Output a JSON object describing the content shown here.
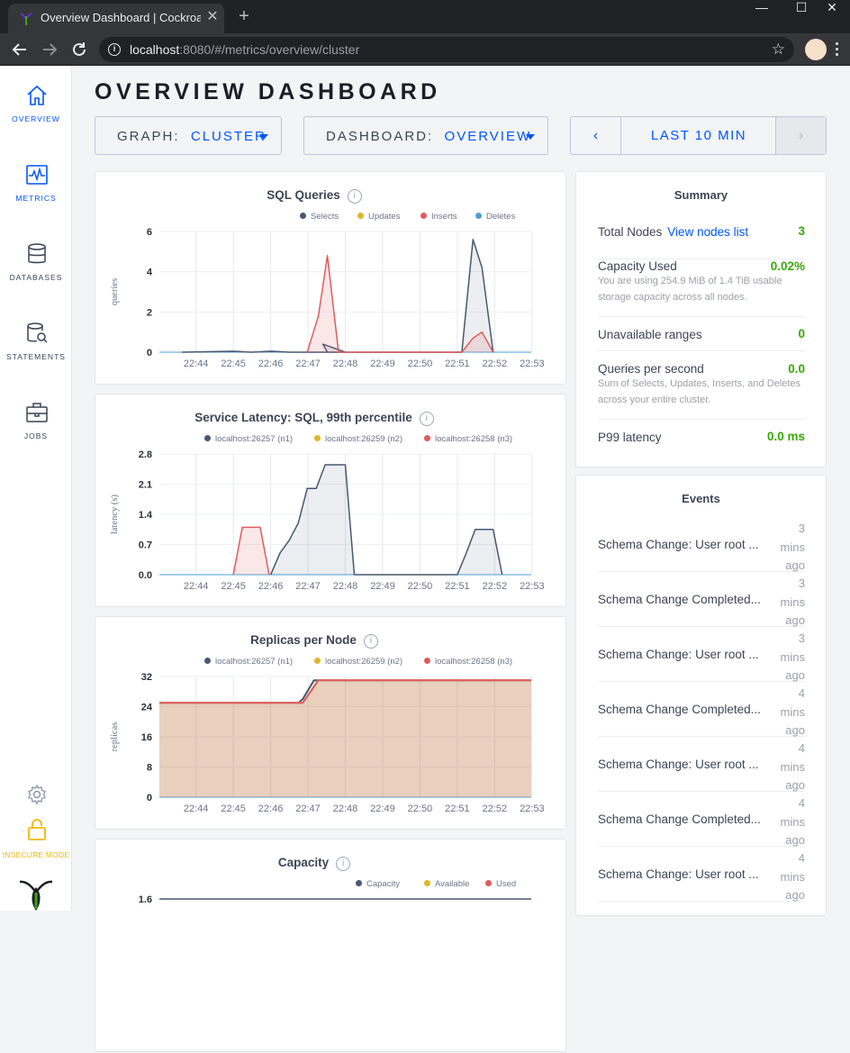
{
  "browser": {
    "tab_title": "Overview Dashboard | Cockroach",
    "url_host": "localhost",
    "url_rest": ":8080/#/metrics/overview/cluster"
  },
  "sidebar": {
    "items": [
      {
        "label": "OVERVIEW",
        "icon": "home-icon"
      },
      {
        "label": "METRICS",
        "icon": "metrics-icon"
      },
      {
        "label": "DATABASES",
        "icon": "database-icon"
      },
      {
        "label": "STATEMENTS",
        "icon": "statements-icon"
      },
      {
        "label": "JOBS",
        "icon": "jobs-icon"
      }
    ],
    "insecure_label": "INSECURE MODE"
  },
  "header": {
    "title": "OVERVIEW DASHBOARD",
    "graph_label": "GRAPH:",
    "graph_value": "CLUSTER",
    "dashboard_label": "DASHBOARD:",
    "dashboard_value": "OVERVIEW",
    "time_range": "LAST 10 MIN"
  },
  "colors": {
    "accent": "#0055ff",
    "n1": "#475872",
    "n2": "#e0b72c",
    "n3": "#e05c5c",
    "deletes": "#4aa0d5",
    "good": "#37a806"
  },
  "chart_data": [
    {
      "type": "area",
      "title": "SQL Queries",
      "ylabel": "queries",
      "ylim": [
        0,
        6
      ],
      "yticks": [
        "6",
        "4",
        "2",
        "0"
      ],
      "x": [
        "22:44",
        "22:45",
        "22:46",
        "22:47",
        "22:48",
        "22:49",
        "22:50",
        "22:51",
        "22:52",
        "22:53"
      ],
      "series": [
        {
          "name": "Selects",
          "color": "#475872",
          "points": [
            [
              22.727,
              0
            ],
            [
              22.75,
              0.05
            ],
            [
              22.758,
              0
            ],
            [
              22.767,
              0.05
            ],
            [
              22.775,
              0
            ],
            [
              22.8,
              0
            ],
            [
              22.792,
              0
            ],
            [
              22.79,
              0.4
            ],
            [
              22.8,
              0
            ],
            [
              22.85,
              0
            ],
            [
              22.852,
              0
            ],
            [
              22.857,
              5.6
            ],
            [
              22.861,
              4.2
            ],
            [
              22.866,
              0
            ]
          ]
        },
        {
          "name": "Updates",
          "color": "#e0b72c",
          "points": []
        },
        {
          "name": "Inserts",
          "color": "#e05c5c",
          "points": [
            [
              22.783,
              0
            ],
            [
              22.788,
              1.8
            ],
            [
              22.792,
              4.8
            ],
            [
              22.797,
              0
            ],
            [
              22.852,
              0
            ],
            [
              22.857,
              0.7
            ],
            [
              22.861,
              1.0
            ],
            [
              22.866,
              0
            ]
          ]
        },
        {
          "name": "Deletes",
          "color": "#4aa0d5",
          "points": []
        }
      ]
    },
    {
      "type": "area",
      "title": "Service Latency: SQL, 99th percentile",
      "ylabel": "latency (s)",
      "ylim": [
        0,
        2.8
      ],
      "yticks": [
        "2.8",
        "2.1",
        "1.4",
        "0.7",
        "0.0"
      ],
      "x": [
        "22:44",
        "22:45",
        "22:46",
        "22:47",
        "22:48",
        "22:49",
        "22:50",
        "22:51",
        "22:52",
        "22:53"
      ],
      "series": [
        {
          "name": "localhost:26257 (n1)",
          "color": "#475872",
          "points": [
            [
              22.7667,
              0
            ],
            [
              22.7708,
              0.5
            ],
            [
              22.775,
              0.8
            ],
            [
              22.779,
              1.2
            ],
            [
              22.783,
              2.0
            ],
            [
              22.787,
              2.0
            ],
            [
              22.791,
              2.55
            ],
            [
              22.8,
              2.55
            ],
            [
              22.804,
              0
            ],
            [
              22.85,
              0
            ],
            [
              22.854,
              0.5
            ],
            [
              22.858,
              1.05
            ],
            [
              22.866,
              1.05
            ],
            [
              22.87,
              0
            ]
          ]
        },
        {
          "name": "localhost:26259 (n2)",
          "color": "#e0b72c",
          "points": []
        },
        {
          "name": "localhost:26258 (n3)",
          "color": "#e05c5c",
          "points": [
            [
              22.75,
              0
            ],
            [
              22.754,
              1.1
            ],
            [
              22.762,
              1.1
            ],
            [
              22.766,
              0
            ]
          ]
        }
      ]
    },
    {
      "type": "area",
      "title": "Replicas per Node",
      "ylabel": "replicas",
      "ylim": [
        0,
        32
      ],
      "yticks": [
        "32",
        "24",
        "16",
        "8",
        "0"
      ],
      "x": [
        "22:44",
        "22:45",
        "22:46",
        "22:47",
        "22:48",
        "22:49",
        "22:50",
        "22:51",
        "22:52",
        "22:53"
      ],
      "series": [
        {
          "name": "localhost:26257 (n1)",
          "color": "#475872",
          "points": [
            [
              22.717,
              25
            ],
            [
              22.779,
              25
            ],
            [
              22.781,
              26
            ],
            [
              22.786,
              31
            ],
            [
              22.883,
              31
            ]
          ]
        },
        {
          "name": "localhost:26259 (n2)",
          "color": "#e0b72c",
          "points": [
            [
              22.717,
              25
            ],
            [
              22.781,
              25
            ],
            [
              22.788,
              31
            ],
            [
              22.883,
              31
            ]
          ]
        },
        {
          "name": "localhost:26258 (n3)",
          "color": "#e05c5c",
          "points": [
            [
              22.717,
              25
            ],
            [
              22.781,
              25
            ],
            [
              22.788,
              31
            ],
            [
              22.883,
              31
            ]
          ]
        }
      ]
    },
    {
      "type": "area",
      "title": "Capacity",
      "ylabel": "",
      "ylim": [
        0,
        1.6
      ],
      "yticks": [
        "1.6"
      ],
      "x": [],
      "series": [
        {
          "name": "Capacity",
          "color": "#475872",
          "points": [
            [
              22.717,
              1.6
            ],
            [
              22.883,
              1.6
            ]
          ]
        },
        {
          "name": "Available",
          "color": "#e0b72c",
          "points": []
        },
        {
          "name": "Used",
          "color": "#e05c5c",
          "points": []
        }
      ]
    }
  ],
  "summary": {
    "title": "Summary",
    "total_nodes_label": "Total Nodes",
    "view_nodes_link": "View nodes list",
    "total_nodes_value": "3",
    "capacity_label": "Capacity Used",
    "capacity_value": "0.02%",
    "capacity_desc": "You are using 254.9 MiB of 1.4 TiB usable storage capacity across all nodes.",
    "unavailable_label": "Unavailable ranges",
    "unavailable_value": "0",
    "qps_label": "Queries per second",
    "qps_value": "0.0",
    "qps_desc": "Sum of Selects, Updates, Inserts, and Deletes across your entire cluster.",
    "p99_label": "P99 latency",
    "p99_value": "0.0 ms"
  },
  "events": {
    "title": "Events",
    "items": [
      {
        "text": "Schema Change: User root ...",
        "n": "3",
        "unit": "mins",
        "ago": "ago"
      },
      {
        "text": "Schema Change Completed...",
        "n": "3",
        "unit": "mins",
        "ago": "ago"
      },
      {
        "text": "Schema Change: User root ...",
        "n": "3",
        "unit": "mins",
        "ago": "ago"
      },
      {
        "text": "Schema Change Completed...",
        "n": "4",
        "unit": "mins",
        "ago": "ago"
      },
      {
        "text": "Schema Change: User root ...",
        "n": "4",
        "unit": "mins",
        "ago": "ago"
      },
      {
        "text": "Schema Change Completed...",
        "n": "4",
        "unit": "mins",
        "ago": "ago"
      },
      {
        "text": "Schema Change: User root ...",
        "n": "4",
        "unit": "mins",
        "ago": "ago"
      }
    ]
  }
}
